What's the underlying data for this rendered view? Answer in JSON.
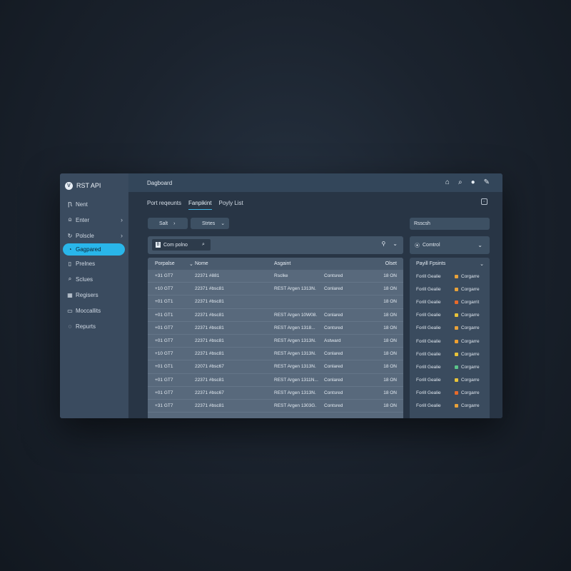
{
  "app": {
    "title": "RST API",
    "logo_letter": "V"
  },
  "header": {
    "title": "Dagboard"
  },
  "sidebar": {
    "items": [
      {
        "label": "Nent",
        "icon": "n-icon",
        "glyph": "Ꞃ"
      },
      {
        "label": "Enter",
        "icon": "person-icon",
        "glyph": "⍝",
        "chevron": "›"
      },
      {
        "label": "Polscle",
        "icon": "refresh-icon",
        "glyph": "↻",
        "chevron": "›"
      },
      {
        "label": "Gagpared",
        "icon": "gauge-icon",
        "glyph": "◔",
        "active": true
      },
      {
        "label": "Prelnes",
        "icon": "document-icon",
        "glyph": "▯"
      },
      {
        "label": "Sclues",
        "icon": "search-icon",
        "glyph": "⌕"
      },
      {
        "label": "Regisers",
        "icon": "grid-icon",
        "glyph": "▦"
      },
      {
        "label": "Moccallits",
        "icon": "folder-icon",
        "glyph": "▭"
      },
      {
        "label": "Repurts",
        "icon": "chat-icon",
        "glyph": "◌"
      }
    ]
  },
  "topbar_icons": [
    {
      "name": "home-icon",
      "glyph": "⌂"
    },
    {
      "name": "search-icon",
      "glyph": "⌕"
    },
    {
      "name": "user-icon",
      "glyph": "●"
    },
    {
      "name": "pencil-icon",
      "glyph": "✎"
    }
  ],
  "tabs": [
    {
      "label": "Port reqeunts"
    },
    {
      "label": "Fanpikint",
      "active": true
    },
    {
      "label": "Poyly List"
    }
  ],
  "toolbar": {
    "btn1": "Salt",
    "btn1_arrow": "›",
    "btn2": "Strtes",
    "btn2_arrow": "⌄"
  },
  "search": {
    "prefix": "B",
    "value": "Com polno",
    "mag": "⌕",
    "user_glyph": "⚲",
    "chev": "⌄"
  },
  "table": {
    "columns": [
      "Porpalse",
      "Nome",
      "Asgaint",
      "",
      "Olset"
    ],
    "sort_chev": "⌄",
    "rows": [
      [
        "+31 GT7",
        "22371 #881",
        "Rsclke",
        "Contsred",
        "18 ON"
      ],
      [
        "+10 GT7",
        "22371 #bsc81",
        "REST Argen 1313N.",
        "Conlared",
        "18 ON"
      ],
      [
        "+01 GT1",
        "22371 #bsc81",
        "",
        "",
        "18 ON"
      ],
      [
        "+01 GT1",
        "22371 #bsc81",
        "REST Argen 10W08.",
        "Conlared",
        "18 ON"
      ],
      [
        "+01 GT7",
        "22371 #bsc81",
        "REST Argen 1318...",
        "Contsred",
        "18 ON"
      ],
      [
        "+01 GT7",
        "22371 #bsc81",
        "REST Argen 1313N.",
        "Astward",
        "18 ON"
      ],
      [
        "+10 GT7",
        "22371 #bsc81",
        "REST Argen 1313N.",
        "Conlared",
        "18 ON"
      ],
      [
        "+01 GT1",
        "22071 #bsc67",
        "REST Argen 1313N.",
        "Conlared",
        "18 ON"
      ],
      [
        "+01 GT7",
        "22371 #bsc81",
        "REST Argen 1311N...",
        "Conlared",
        "18 ON"
      ],
      [
        "+01 GT7",
        "22371 #bsc67",
        "REST Argen 1313N.",
        "Contsred",
        "18 ON"
      ],
      [
        "+31 GT7",
        "22371 #bsc81",
        "REST Argen 1303G.",
        "Contsred",
        "18 ON"
      ]
    ]
  },
  "right": {
    "search_label": "Rsscsh",
    "control_label": "Comtrol",
    "control_glyph": "⦿",
    "control_chev": "⌄",
    "head": "Payill Fpsints",
    "head_chev": "⌄",
    "rows": [
      {
        "name": "Forill Gealie",
        "tag": "Corgarre",
        "color": "#e8a23a"
      },
      {
        "name": "Forill Gealie",
        "tag": "Corgarre",
        "color": "#e8a23a"
      },
      {
        "name": "Forill Gealie",
        "tag": "Corgarrit",
        "color": "#e86a2a"
      },
      {
        "name": "Forill Gealie",
        "tag": "Corgarre",
        "color": "#e8c33a"
      },
      {
        "name": "Forill Gealie",
        "tag": "Corgarre",
        "color": "#e8a23a"
      },
      {
        "name": "Forill Gealie",
        "tag": "Corgarre",
        "color": "#f0a030"
      },
      {
        "name": "Forill Gealie",
        "tag": "Corgarre",
        "color": "#e8c33a"
      },
      {
        "name": "Forill Gealie",
        "tag": "Corgarre",
        "color": "#5bc48a"
      },
      {
        "name": "Forill Gealie",
        "tag": "Corgarre",
        "color": "#e8c33a"
      },
      {
        "name": "Forill Gealie",
        "tag": "Corgarre",
        "color": "#e86a2a"
      },
      {
        "name": "Forill Gealie",
        "tag": "Corgarre",
        "color": "#e8a23a"
      }
    ]
  }
}
